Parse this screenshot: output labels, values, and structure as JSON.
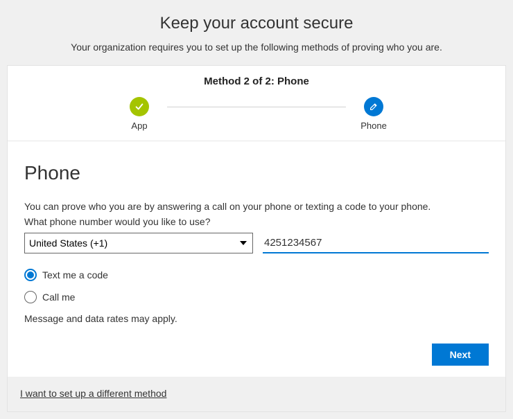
{
  "header": {
    "title": "Keep your account secure",
    "subtitle": "Your organization requires you to set up the following methods of proving who you are."
  },
  "steps": {
    "label": "Method 2 of 2: Phone",
    "items": [
      {
        "label": "App",
        "state": "complete"
      },
      {
        "label": "Phone",
        "state": "current"
      }
    ]
  },
  "section": {
    "heading": "Phone",
    "description": "You can prove who you are by answering a call on your phone or texting a code to your phone.",
    "prompt": "What phone number would you like to use?",
    "country_value": "United States (+1)",
    "phone_value": "4251234567",
    "options": {
      "text_label": "Text me a code",
      "call_label": "Call me",
      "selected": "text"
    },
    "rates_note": "Message and data rates may apply.",
    "next_label": "Next"
  },
  "footer": {
    "alt_method": "I want to set up a different method"
  }
}
